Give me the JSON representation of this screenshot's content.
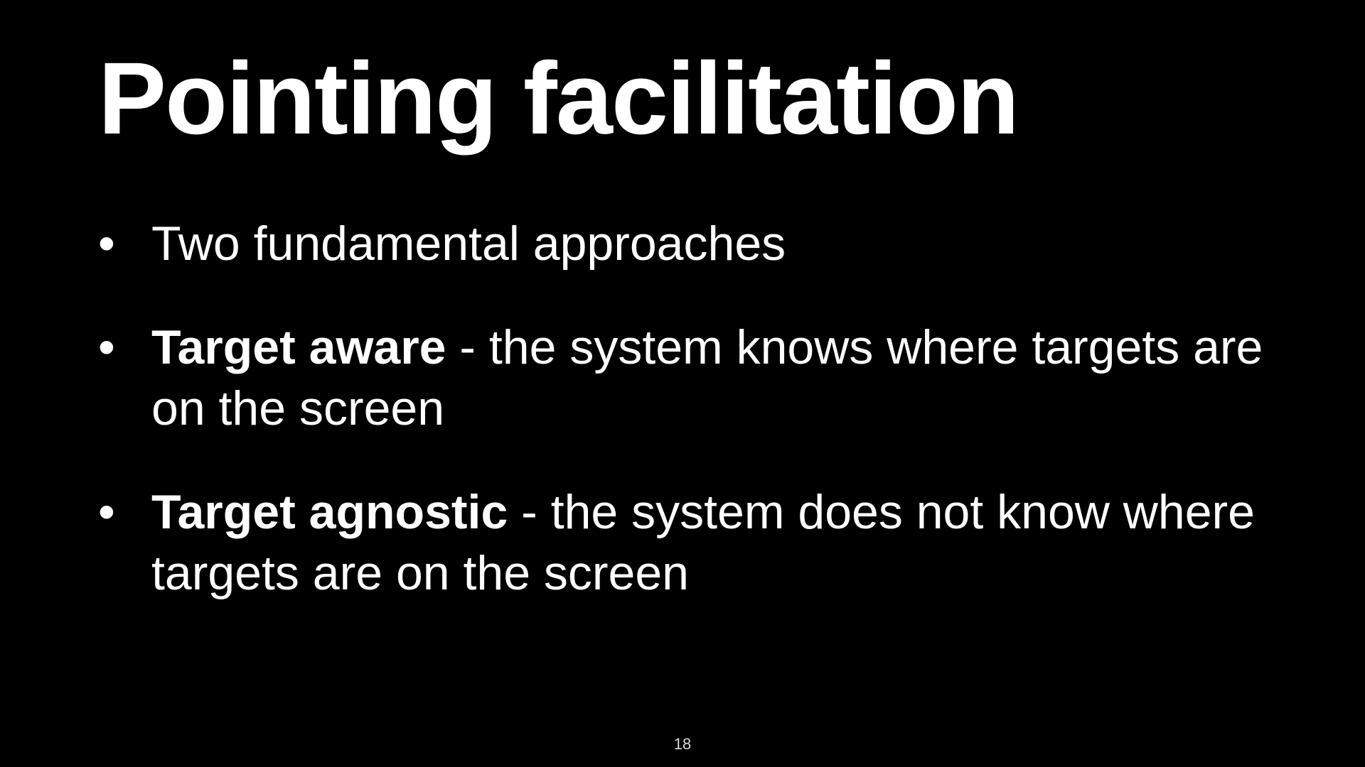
{
  "slide": {
    "title": "Pointing facilitation",
    "bullets": [
      {
        "bold": "",
        "text": "Two fundamental approaches"
      },
      {
        "bold": "Target aware",
        "text": " - the system knows where targets are on the screen"
      },
      {
        "bold": "Target agnostic",
        "text": " - the system does not know where targets are on the screen"
      }
    ],
    "bullet_glyph": "•",
    "page_number": "18"
  },
  "colors": {
    "background": "#000000",
    "text": "#ffffff"
  }
}
